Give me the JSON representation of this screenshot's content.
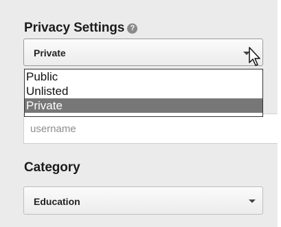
{
  "privacy": {
    "heading": "Privacy Settings",
    "help_icon": "question-mark-icon",
    "help_glyph": "?",
    "selected": "Private",
    "options": [
      "Public",
      "Unlisted",
      "Private"
    ]
  },
  "title_field": {
    "placeholder": "username"
  },
  "category": {
    "heading": "Category",
    "selected": "Education"
  },
  "colors": {
    "background": "#ebebeb",
    "highlight": "#777777"
  }
}
